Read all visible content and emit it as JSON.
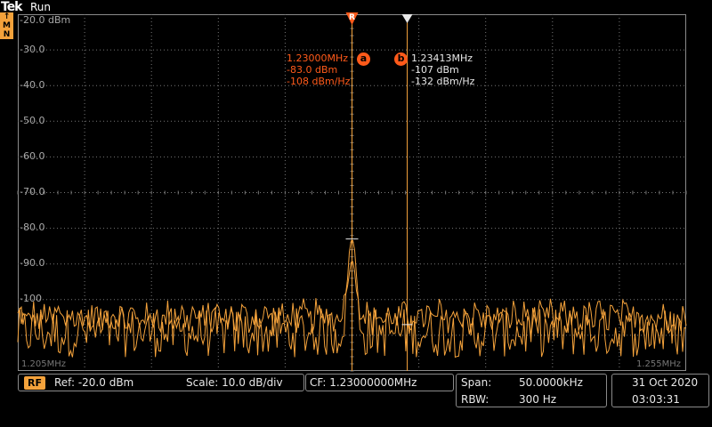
{
  "header": {
    "logo": "Tek",
    "status": "Run",
    "badges": [
      "M",
      "N"
    ],
    "badges_top": "↑"
  },
  "y_axis": {
    "labels": [
      "-20.0 dBm",
      "-30.0",
      "-40.0",
      "-50.0",
      "-60.0",
      "-70.0",
      "-80.0",
      "-90.0",
      "-100"
    ]
  },
  "x_axis": {
    "start": "1.205MHz",
    "stop": "1.255MHz"
  },
  "markers": {
    "reference": {
      "glyph": "R",
      "id": "a",
      "freq": "1.23000MHz",
      "level": "-83.0 dBm",
      "density": "-108 dBm/Hz",
      "color": "#ff5a1a"
    },
    "delta": {
      "id": "b",
      "freq": "1.23413MHz",
      "level": "-107 dBm",
      "density": "-132 dBm/Hz",
      "color": "#e8e8e8"
    }
  },
  "status": {
    "rf_label": "RF",
    "ref": "Ref: -20.0 dBm",
    "scale": "Scale: 10.0 dB/div",
    "cf": "CF:  1.23000000MHz",
    "span_label": "Span:",
    "span_value": "50.0000kHz",
    "rbw_label": "RBW:",
    "rbw_value": "300 Hz",
    "date": "31 Oct  2020",
    "time": "03:03:31"
  },
  "chart_data": {
    "type": "line",
    "x_range": [
      1.205,
      1.255
    ],
    "ylim": [
      -120,
      -20
    ],
    "grid": true,
    "peak": {
      "x": 1.23,
      "y": -83.0
    },
    "noise_floor": -105,
    "series": [
      {
        "values": []
      },
      {
        "values": []
      }
    ],
    "colors": {
      "trace": "#f4a23b",
      "marker_ref": "#ff5a1a",
      "marker_delta": "#e8e8e8",
      "grid": "#777777"
    }
  }
}
